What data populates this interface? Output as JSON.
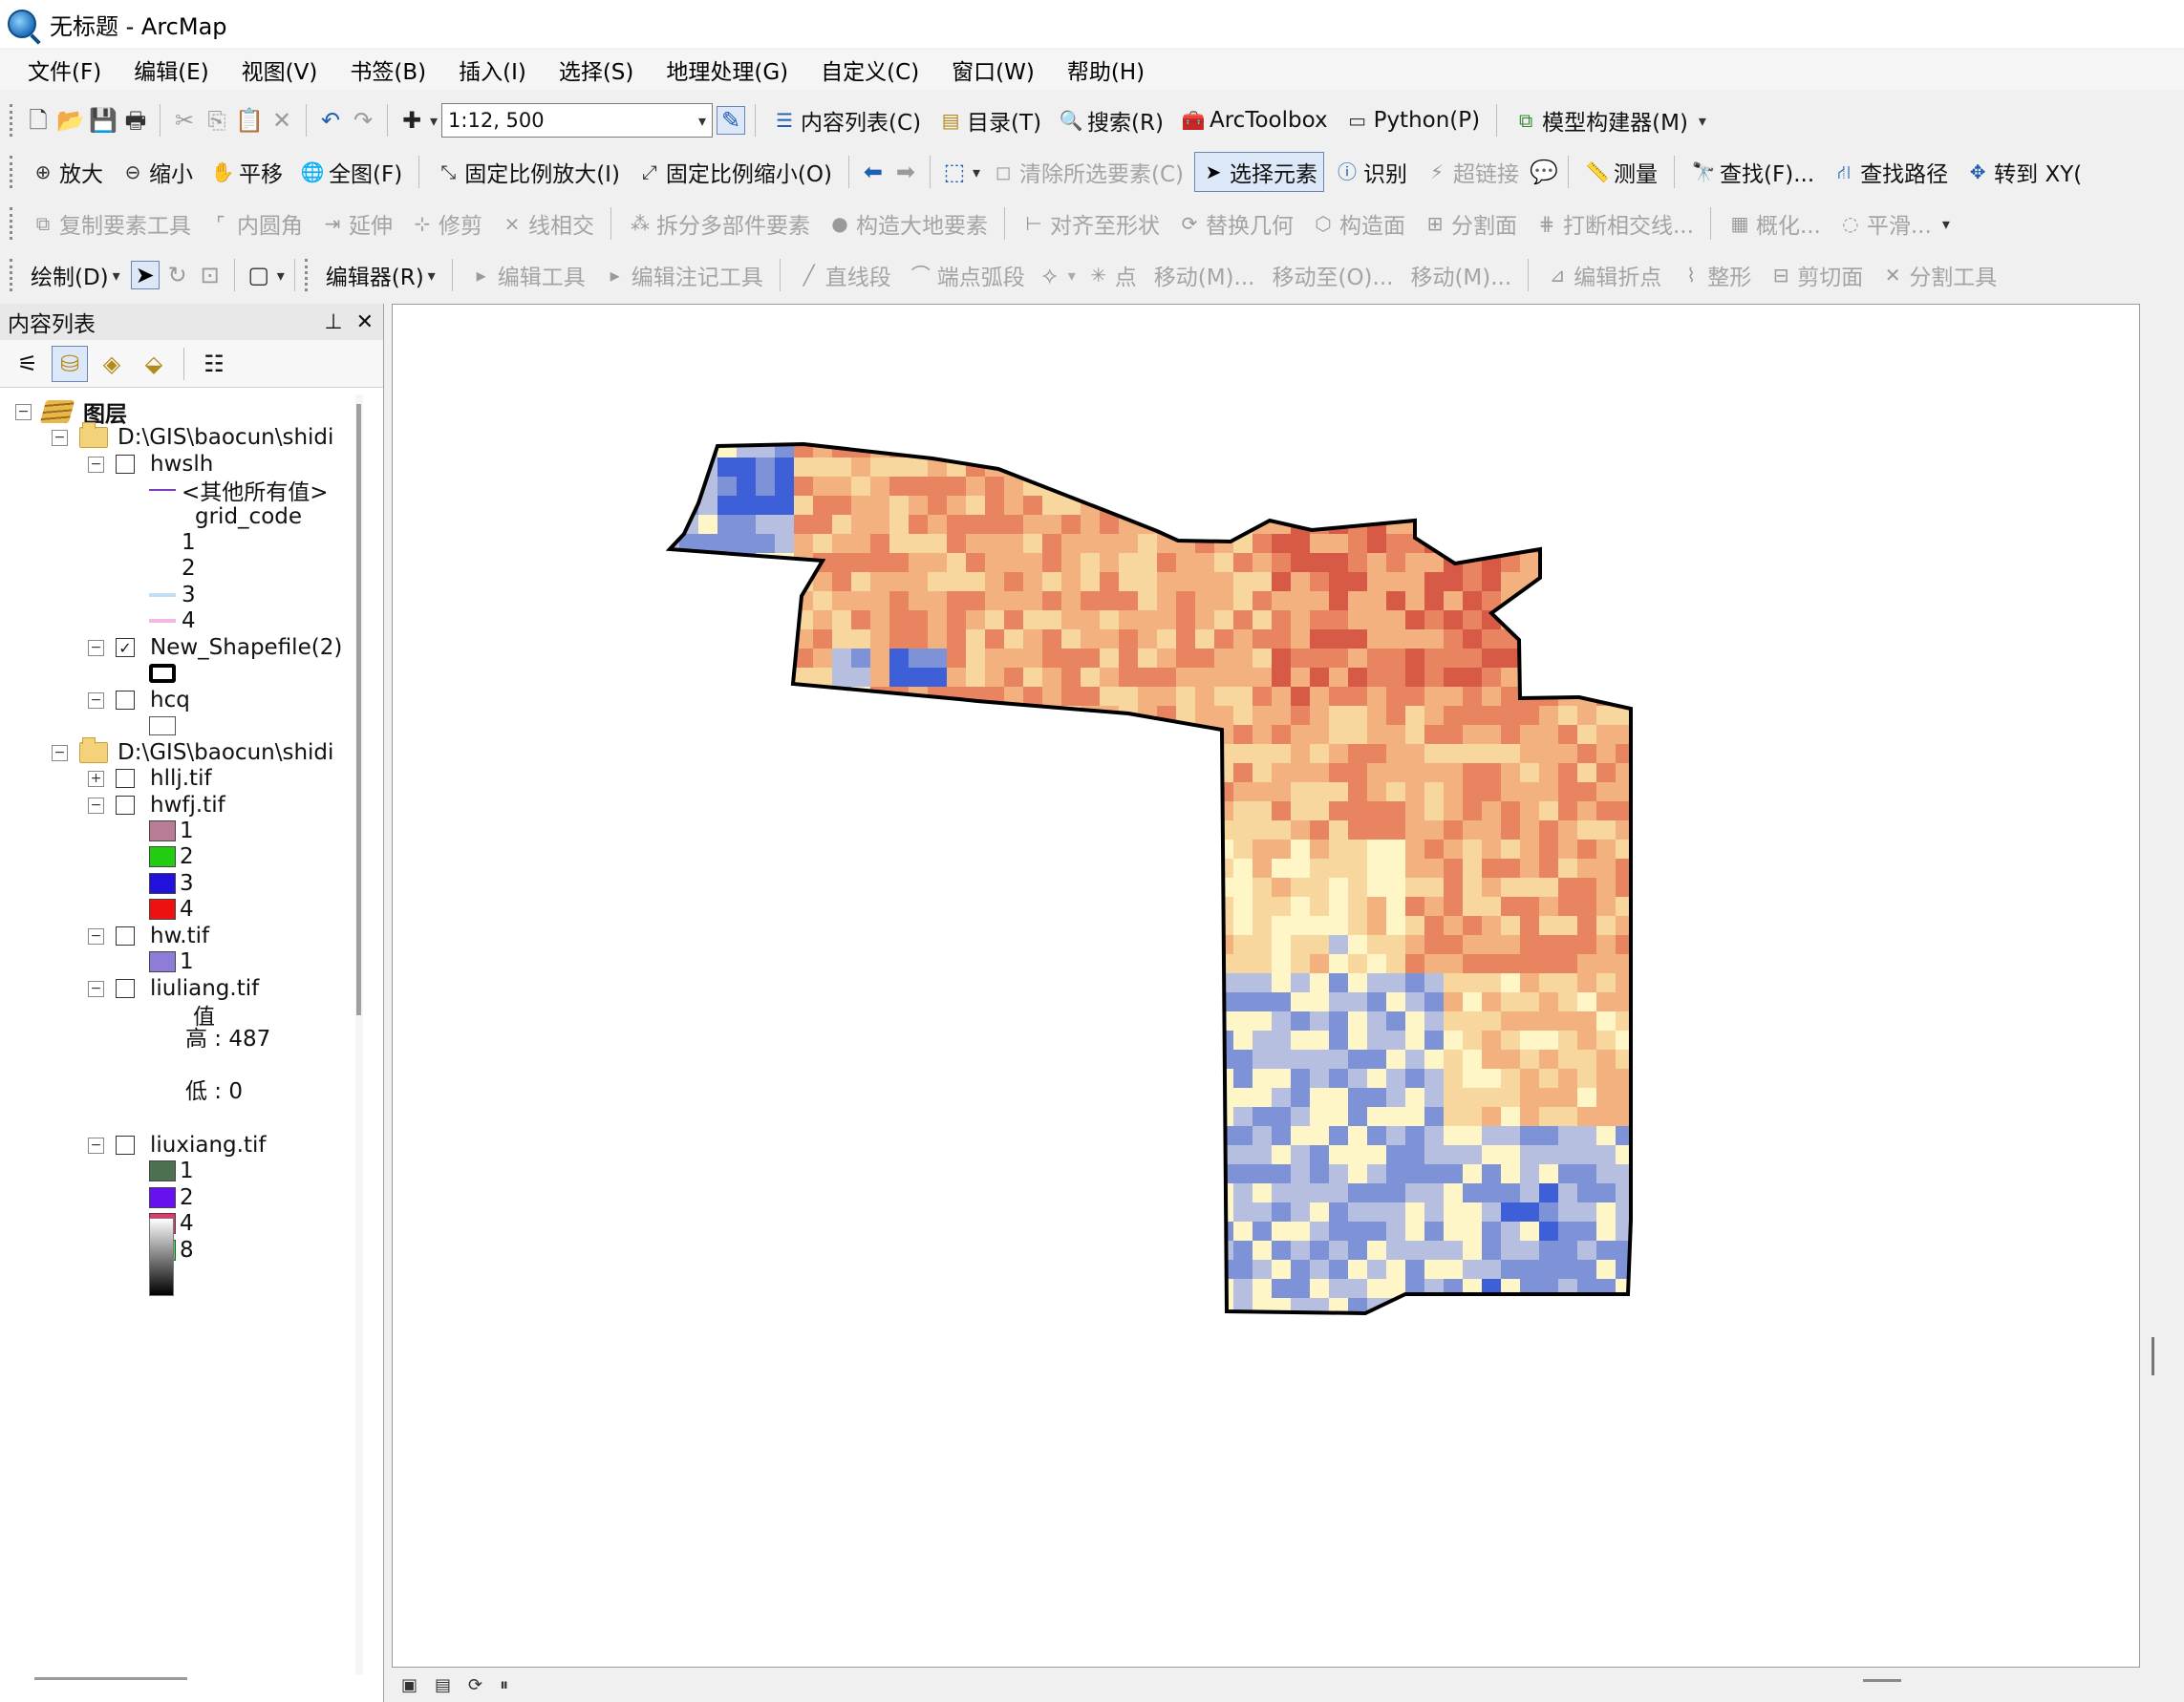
{
  "window": {
    "title": "无标题 - ArcMap"
  },
  "menu": [
    "文件(F)",
    "编辑(E)",
    "视图(V)",
    "书签(B)",
    "插入(I)",
    "选择(S)",
    "地理处理(G)",
    "自定义(C)",
    "窗口(W)",
    "帮助(H)"
  ],
  "toolbar_standard": {
    "scale": "1:12, 500",
    "toc_label": "内容列表(C)",
    "catalog_label": "目录(T)",
    "search_label": "搜索(R)",
    "arctoolbox_label": "ArcToolbox",
    "python_label": "Python(P)",
    "model_builder_label": "模型构建器(M)"
  },
  "toolbar_tools": {
    "zoom_in": "放大",
    "zoom_out": "缩小",
    "pan": "平移",
    "full_extent": "全图(F)",
    "fixed_zoom_in": "固定比例放大(I)",
    "fixed_zoom_out": "固定比例缩小(O)",
    "clear_selection": "清除所选要素(C)",
    "select_elements": "选择元素",
    "identify": "识别",
    "hyperlink": "超链接",
    "measure": "测量",
    "find": "查找(F)...",
    "find_route": "查找路径",
    "goto_xy": "转到 XY("
  },
  "toolbar_advanced_edit": [
    "复制要素工具",
    "内圆角",
    "延伸",
    "修剪",
    "线相交",
    "拆分多部件要素",
    "构造大地要素",
    "对齐至形状",
    "替换几何",
    "构造面",
    "分割面",
    "打断相交线...",
    "概化...",
    "平滑..."
  ],
  "toolbar_draw": {
    "label": "绘制(D)"
  },
  "toolbar_editor": {
    "editor_label": "编辑器(R)",
    "edit_tool": "编辑工具",
    "annotation_tool": "编辑注记工具",
    "straight_segment": "直线段",
    "endpoint_arc": "端点弧段",
    "point": "点",
    "move": "移动(M)...",
    "move_to": "移动至(O)...",
    "move2": "移动(M)...",
    "edit_vertices": "编辑折点",
    "reshape": "整形",
    "cut_polygon": "剪切面",
    "split_tool": "分割工具"
  },
  "toc": {
    "title": "内容列表",
    "root": "图层",
    "group1": "D:\\GIS\\baocun\\shidi",
    "hwslh": "hwslh",
    "hwslh_other": "<其他所有值>",
    "hwslh_field": "grid_code",
    "hwslh_classes": [
      "1",
      "2",
      "3",
      "4"
    ],
    "new_shapefile": "New_Shapefile(2)",
    "hcq": "hcq",
    "group2": "D:\\GIS\\baocun\\shidi",
    "hllj": "hllj.tif",
    "hwfj": "hwfj.tif",
    "hwfj_classes": [
      "1",
      "2",
      "3",
      "4"
    ],
    "hwfj_colors": [
      "#b87c96",
      "#22cc11",
      "#2211dd",
      "#ee1111"
    ],
    "hw": "hw.tif",
    "hw_classes": [
      "1"
    ],
    "hw_color": "#8f7bd8",
    "liuliang": "liuliang.tif",
    "liuliang_value": "值",
    "liuliang_high": "高 : 487",
    "liuliang_low": "低 : 0",
    "liuxiang": "liuxiang.tif",
    "liuxiang_classes": [
      "1",
      "2",
      "4",
      "8"
    ],
    "liuxiang_colors": [
      "#4d7050",
      "#6611ee",
      "#ee3366",
      "#33ee44"
    ]
  },
  "map": {
    "palette": [
      "#3d5fd8",
      "#7e92d8",
      "#b7bfe0",
      "#fff6c8",
      "#f8d79e",
      "#f3b17f",
      "#e98460",
      "#d65a45"
    ]
  }
}
